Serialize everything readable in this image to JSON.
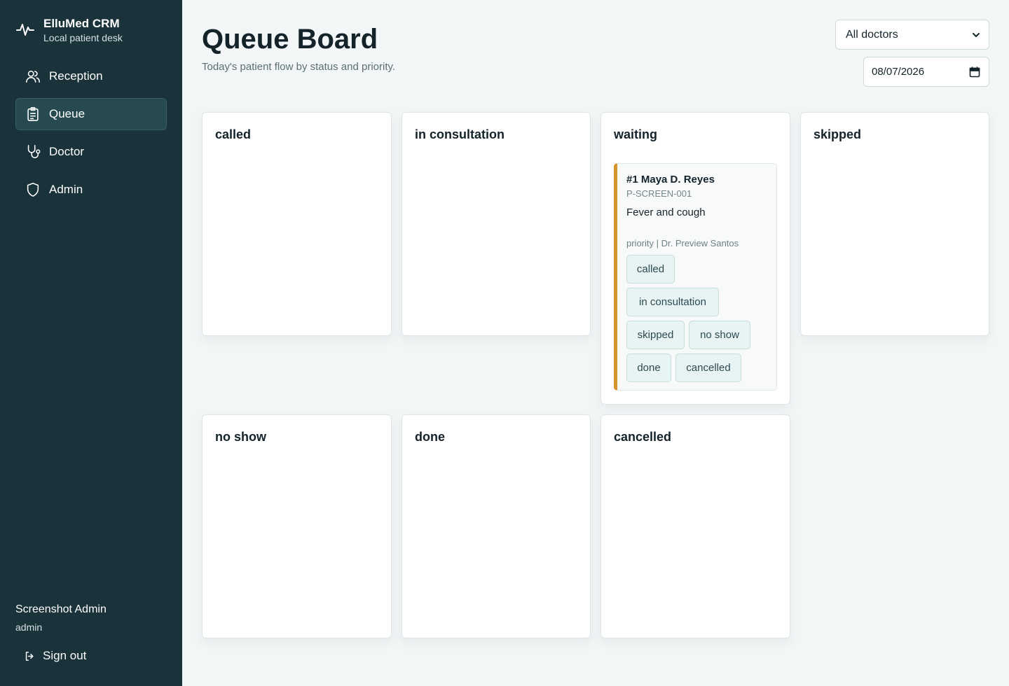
{
  "app": {
    "name": "ElluMed CRM",
    "subtitle": "Local patient desk"
  },
  "nav": [
    {
      "label": "Reception",
      "icon": "users-icon",
      "active": false
    },
    {
      "label": "Queue",
      "icon": "clipboard-icon",
      "active": true
    },
    {
      "label": "Doctor",
      "icon": "stethoscope-icon",
      "active": false
    },
    {
      "label": "Admin",
      "icon": "shield-icon",
      "active": false
    }
  ],
  "user": {
    "name": "Screenshot Admin",
    "role": "admin",
    "signout_label": "Sign out"
  },
  "page": {
    "title": "Queue Board",
    "subtitle": "Today's patient flow by status and priority."
  },
  "filters": {
    "doctor_selected": "All doctors",
    "date_value": "08/07/2026"
  },
  "columns": [
    {
      "title": "called"
    },
    {
      "title": "in consultation"
    },
    {
      "title": "waiting"
    },
    {
      "title": "skipped"
    },
    {
      "title": "no show"
    },
    {
      "title": "done"
    },
    {
      "title": "cancelled"
    }
  ],
  "queue_card": {
    "number_name": "#1 Maya D. Reyes",
    "patient_code": "P-SCREEN-001",
    "reason": "Fever and cough",
    "meta": "priority | Dr. Preview Santos",
    "accent_color": "#d6922b",
    "actions": [
      "called",
      "in consultation",
      "skipped",
      "no show",
      "done",
      "cancelled"
    ]
  },
  "colors": {
    "sidebar": "#1a323a",
    "active_nav": "#264a50",
    "background": "#f2f6f6",
    "accent": "#d6922b"
  }
}
